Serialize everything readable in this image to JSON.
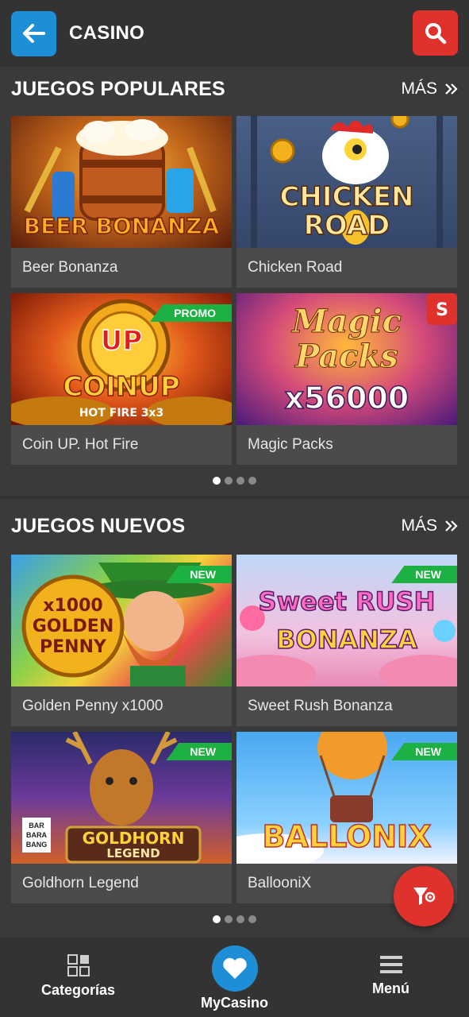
{
  "header": {
    "title": "CASINO"
  },
  "popular": {
    "title": "JUEGOS POPULARES",
    "more_label": "MÁS",
    "games": [
      {
        "name": "Beer Bonanza",
        "art": "BEER BONANZA",
        "badge": ""
      },
      {
        "name": "Chicken Road",
        "art": "CHICKEN ROAD",
        "badge": ""
      },
      {
        "name": "Coin UP. Hot Fire",
        "art": "COINUP",
        "art_sub": "HOT FIRE 3x3",
        "badge": "PROMO"
      },
      {
        "name": "Magic Packs",
        "art": "Magic Packs",
        "art_sub": "x56000",
        "badge": ""
      }
    ],
    "pages": 4,
    "active_page": 1
  },
  "new_games": {
    "title": "JUEGOS NUEVOS",
    "more_label": "MÁS",
    "games": [
      {
        "name": "Golden Penny x1000",
        "art": "x1000 GOLDEN PENNY",
        "badge": "NEW"
      },
      {
        "name": "Sweet Rush Bonanza",
        "art": "Sweet RUSH",
        "art_sub": "BONANZA",
        "badge": "NEW"
      },
      {
        "name": "Goldhorn Legend",
        "art": "GOLDHORN",
        "art_sub": "LEGEND",
        "badge": "NEW"
      },
      {
        "name": "BallooniX",
        "art": "BALLONIX",
        "badge": "NEW"
      }
    ],
    "pages": 4,
    "active_page": 1
  },
  "bottom_nav": {
    "categories": "Categorías",
    "mycasino": "MyCasino",
    "menu": "Menú"
  },
  "colors": {
    "accent_blue": "#1e8fd6",
    "accent_red": "#e0322c",
    "badge_green": "#1db042"
  }
}
